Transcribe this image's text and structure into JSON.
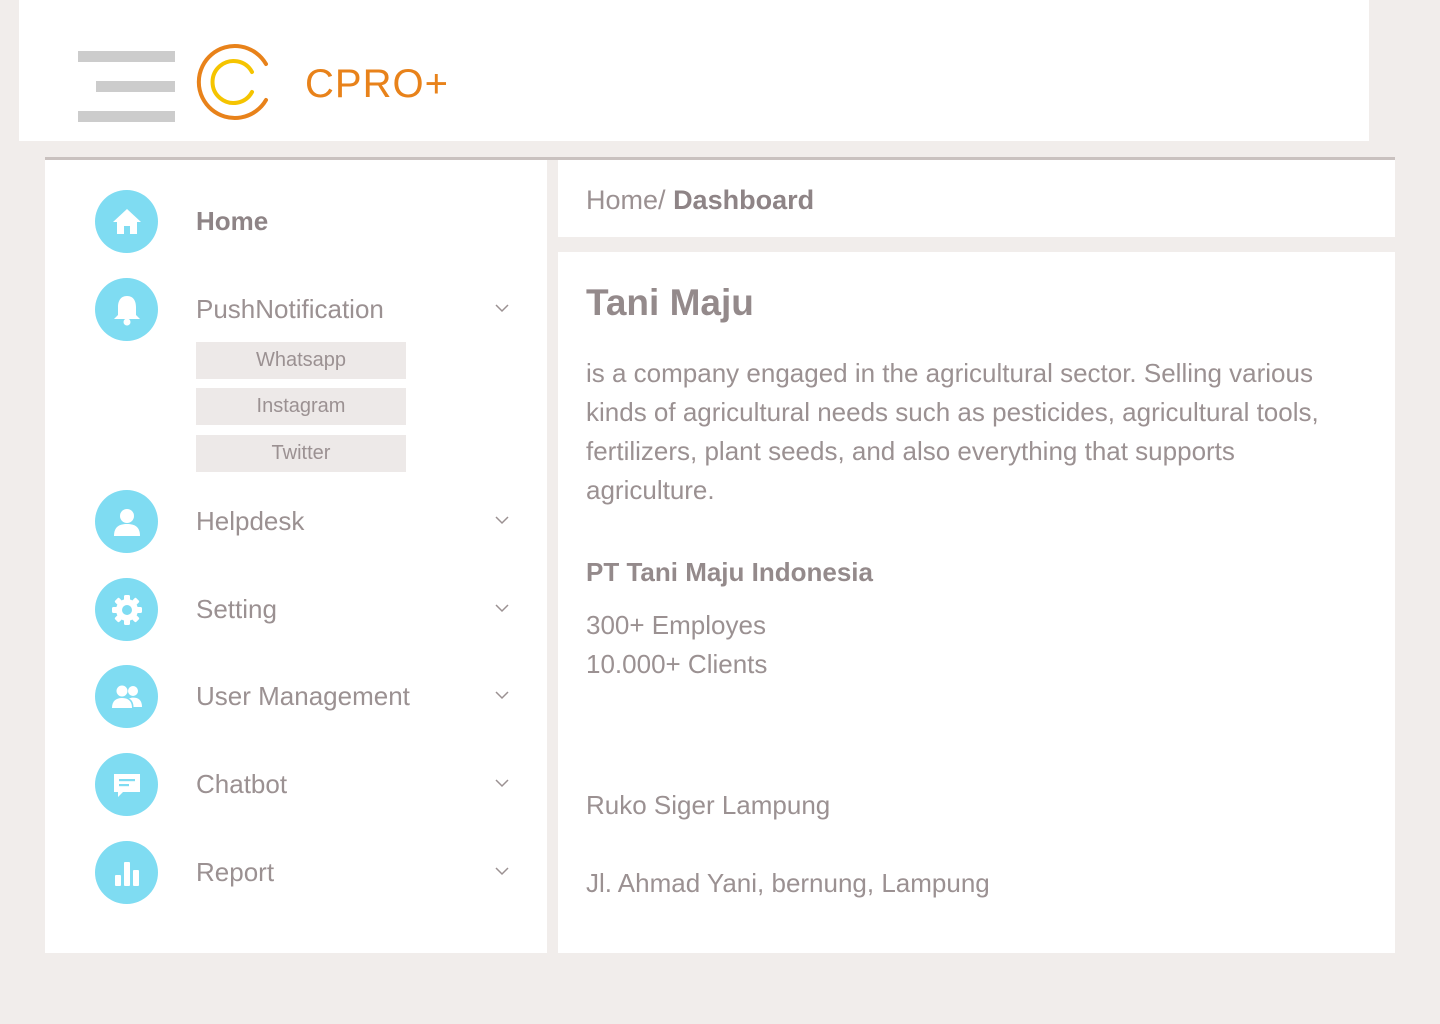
{
  "app": {
    "name": "CPRO+",
    "colors": {
      "background": "#f1edeb",
      "panel": "#ffffff",
      "brand_orange": "#e8821a",
      "brand_yellow": "#f5c400",
      "icon_circle": "#7fdcf2",
      "text": "#9b9192",
      "hamburger": "#cccccc"
    }
  },
  "topbar": {
    "menu_icon": "hamburger-menu-icon",
    "logo_icon": "cpro-logo-icon",
    "logo_text": "CPRO+"
  },
  "sidebar": {
    "items": [
      {
        "label": "Home",
        "icon": "home-icon",
        "expandable": false
      },
      {
        "label": "PushNotification",
        "icon": "bell-icon",
        "expandable": true,
        "subitems": [
          {
            "label": "Whatsapp"
          },
          {
            "label": "Instagram"
          },
          {
            "label": "Twitter"
          }
        ]
      },
      {
        "label": "Helpdesk",
        "icon": "user-icon",
        "expandable": true
      },
      {
        "label": "Setting",
        "icon": "gear-icon",
        "expandable": true
      },
      {
        "label": "User Management",
        "icon": "users-icon",
        "expandable": true
      },
      {
        "label": "Chatbot",
        "icon": "chat-icon",
        "expandable": true
      },
      {
        "label": "Report",
        "icon": "bar-chart-icon",
        "expandable": true
      }
    ]
  },
  "breadcrumb": {
    "home": "Home",
    "separator": "/",
    "current": "Dashboard"
  },
  "content": {
    "title": "Tani Maju",
    "description": "is a company engaged in the agricultural sector. Selling various kinds of agricultural needs such as pesticides, agricultural tools, fertilizers, plant seeds, and also everything that supports agriculture.",
    "company": "PT Tani Maju Indonesia",
    "employees": "300+ Employes",
    "clients": "10.000+ Clients",
    "address_line1": "Ruko Siger Lampung",
    "address_line2": "Jl. Ahmad Yani, bernung, Lampung"
  }
}
